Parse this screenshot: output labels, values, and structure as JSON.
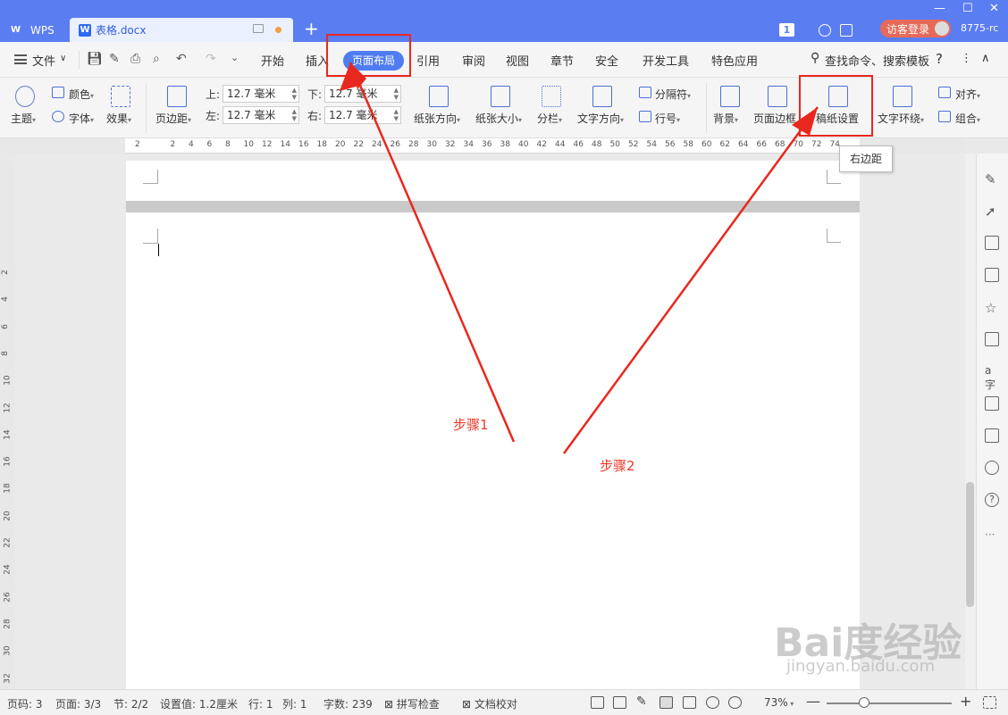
{
  "titlebar": {
    "app_label": "WPS",
    "doc_tab": "表格.docx",
    "new_tab_symbol": "+",
    "badge": "1",
    "login": "访客登录",
    "user_id": "8775-rc"
  },
  "menu": {
    "file": "文件",
    "items": [
      "开始",
      "插入",
      "页面布局",
      "引用",
      "审阅",
      "视图",
      "章节",
      "安全",
      "开发工具",
      "特色应用"
    ],
    "active": "页面布局",
    "search": "查找命令、搜索模板"
  },
  "ribbon": {
    "colors": "颜色",
    "theme": "主题",
    "font": "字体",
    "effects": "效果",
    "margins": "页边距",
    "top_label": "上:",
    "top_value": "12.7 毫米",
    "bottom_label": "下:",
    "bottom_value": "12.7 毫米",
    "left_label": "左:",
    "left_value": "12.7 毫米",
    "right_label": "右:",
    "right_value": "12.7 毫米",
    "orientation": "纸张方向",
    "size": "纸张大小",
    "columns": "分栏",
    "text_direction": "文字方向",
    "breaks": "分隔符",
    "line_numbers": "行号",
    "background": "背景",
    "page_border": "页面边框",
    "manuscript": "稿纸设置",
    "wrap": "文字环绕",
    "align": "对齐",
    "group": "组合"
  },
  "ruler_labels": [
    "2",
    "2",
    "4",
    "6",
    "8",
    "10",
    "12",
    "14",
    "16",
    "18",
    "20",
    "22",
    "24",
    "26",
    "28",
    "30",
    "32",
    "34",
    "36",
    "38",
    "40",
    "42",
    "44",
    "46",
    "48",
    "50",
    "52",
    "54",
    "56",
    "58",
    "60",
    "62",
    "64",
    "66",
    "68",
    "70",
    "72",
    "74"
  ],
  "vruler_labels": [
    "2",
    "4",
    "6",
    "8",
    "10",
    "12",
    "14",
    "16",
    "18",
    "20",
    "22",
    "24",
    "26",
    "28",
    "30",
    "32"
  ],
  "tooltip": "右边距",
  "annotations": {
    "step1": "步骤1",
    "step2": "步骤2",
    "color": "#e8281e"
  },
  "statusbar": {
    "page_code": "页码: 3",
    "page": "页面: 3/3",
    "section": "节: 2/2",
    "setting": "设置值: 1.2厘米",
    "row": "行: 1",
    "col": "列: 1",
    "words": "字数: 239",
    "spell": "拼写检查",
    "proof": "文档校对",
    "zoom": "73%",
    "zoom_level": 0.3
  },
  "watermark": {
    "main": "Bai度经验",
    "sub": "jingyan.baidu.com"
  },
  "colors": {
    "title_blue": "#5b7df2",
    "active_tab": "#4f7cf0",
    "login_red": "#e66a5a"
  }
}
